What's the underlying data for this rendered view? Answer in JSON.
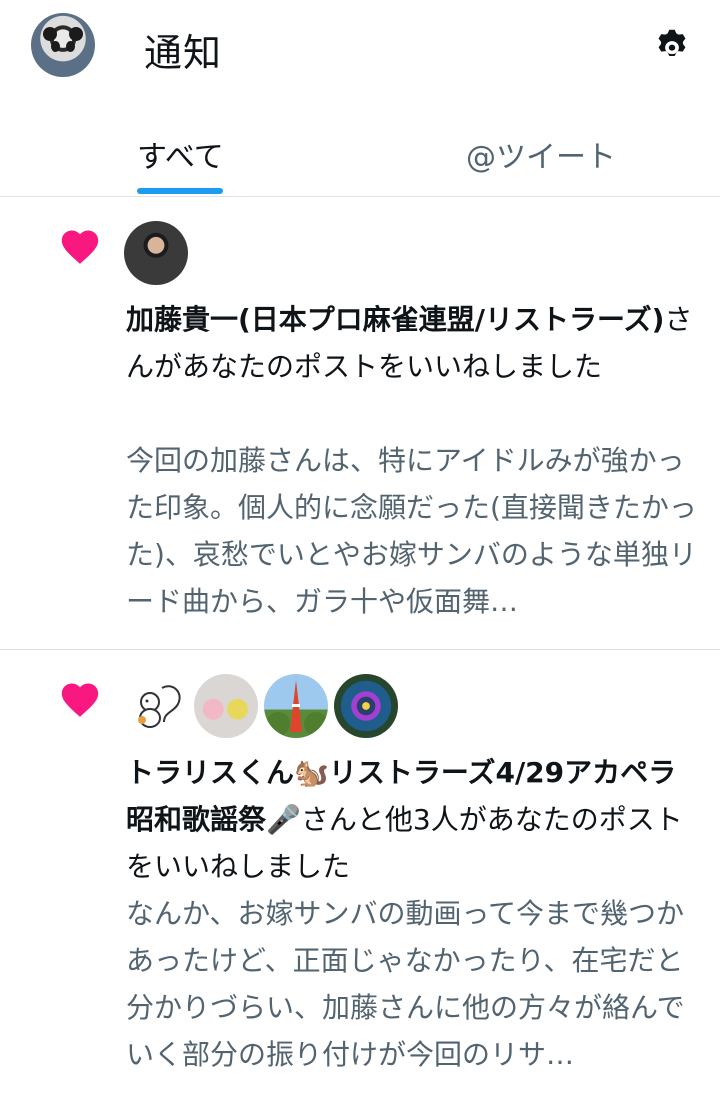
{
  "header": {
    "title": "通知",
    "avatar_icon": "panda-avatar",
    "settings_icon": "gear-icon"
  },
  "tabs": [
    {
      "label": "すべて",
      "active": true
    },
    {
      "label": "@ツイート",
      "active": false
    }
  ],
  "accent": "#1d9bf0",
  "like_color": "#f91880",
  "notifications": [
    {
      "type": "like",
      "name": "加藤貴一(日本プロ麻雀連盟/リストラーズ)",
      "action": "さんがあなたのポストをいいねしました",
      "snippet": "今回の加藤さんは、特にアイドルみが強かった印象。個人的に念願だった(直接聞きたかった)、哀愁でいとやお嫁サンバのような単独リード曲から、ガラ十や仮面舞…"
    },
    {
      "type": "like",
      "name": "トラリスくん🐿️リストラーズ4/29アカペラ昭和歌謡祭🎤",
      "action": "さんと他3人があなたのポストをいいねしました",
      "snippet": "なんか、お嫁サンバの動画って今まで幾つかあったけど、正面じゃなかったり、在宅だと分かりづらい、加藤さんに他の方々が絡んでいく部分の振り付けが今回のリサ…"
    }
  ]
}
